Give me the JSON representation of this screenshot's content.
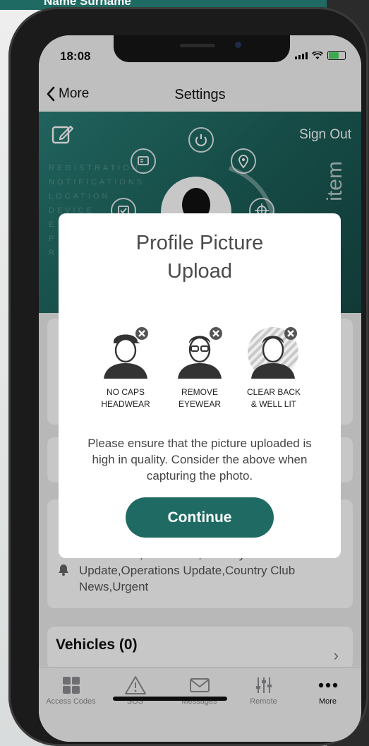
{
  "background": {
    "top_text": "Name Surname"
  },
  "status_bar": {
    "time": "18:08"
  },
  "navbar": {
    "back_label": "More",
    "title": "Settings"
  },
  "hero": {
    "sign_out": "Sign Out",
    "watermark_lines": [
      "REGISTRATION",
      "NOTIFICATIONS",
      "LOCATION",
      "DEVICE",
      "E",
      "P",
      "R"
    ],
    "brand": "item"
  },
  "cards": {
    "notifications_text": "Promotions,Newsflash,Security Update,Operations Update,Country Club News,Urgent",
    "vehicles_title": "Vehicles (0)"
  },
  "modal": {
    "title": "Profile Picture Upload",
    "guides": [
      {
        "label_line1": "NO CAPS",
        "label_line2": "HEADWEAR"
      },
      {
        "label_line1": "REMOVE",
        "label_line2": "EYEWEAR"
      },
      {
        "label_line1": "CLEAR BACK",
        "label_line2": "& WELL LIT"
      }
    ],
    "text": "Please ensure that the picture uploaded is high in quality. Consider the above when capturing the photo.",
    "button": "Continue"
  },
  "tabbar": {
    "tabs": [
      {
        "label": "Access Codes",
        "icon": "grid-icon"
      },
      {
        "label": "SOS",
        "icon": "warning-icon"
      },
      {
        "label": "Messages",
        "icon": "envelope-icon"
      },
      {
        "label": "Remote",
        "icon": "sliders-icon"
      },
      {
        "label": "More",
        "icon": "more-icon"
      }
    ]
  },
  "colors": {
    "accent": "#1f6b63",
    "hero": "#1c5f59"
  }
}
